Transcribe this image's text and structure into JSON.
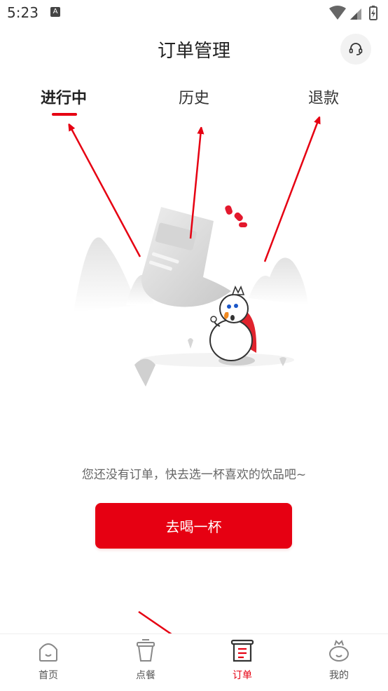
{
  "status_bar": {
    "time": "5:23",
    "notification_icon": "A"
  },
  "header": {
    "title": "订单管理",
    "support_icon": "headset-icon"
  },
  "tabs": [
    {
      "label": "进行中",
      "active": true
    },
    {
      "label": "历史",
      "active": false
    },
    {
      "label": "退款",
      "active": false
    }
  ],
  "empty_state": {
    "message": "您还没有订单，快去选一杯喜欢的饮品吧~",
    "button_label": "去喝一杯"
  },
  "bottom_nav": [
    {
      "label": "首页",
      "icon": "home-icon",
      "active": false
    },
    {
      "label": "点餐",
      "icon": "cup-icon",
      "active": false
    },
    {
      "label": "订单",
      "icon": "order-icon",
      "active": true
    },
    {
      "label": "我的",
      "icon": "profile-icon",
      "active": false
    }
  ],
  "colors": {
    "accent": "#e60012",
    "tab_text": "#333333",
    "muted_text": "#666666"
  }
}
